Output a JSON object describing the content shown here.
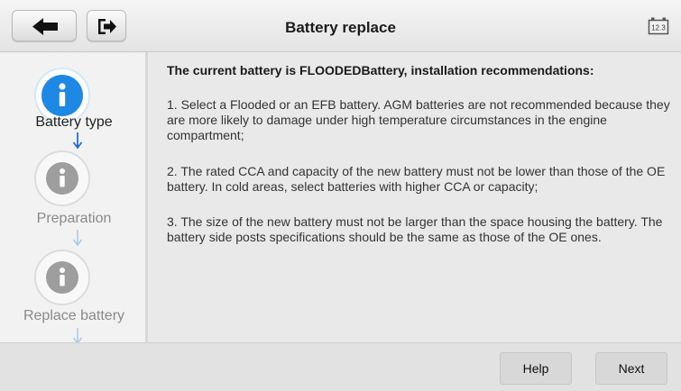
{
  "header": {
    "title": "Battery replace",
    "back_icon": "back-arrow-icon",
    "exit_icon": "exit-icon",
    "battery_icon": "battery-icon",
    "battery_label": "12.3"
  },
  "steps": [
    {
      "label": "Battery type",
      "state": "active",
      "icon": "info-icon"
    },
    {
      "label": "Preparation",
      "state": "inactive",
      "icon": "info-icon"
    },
    {
      "label": "Replace battery",
      "state": "inactive",
      "icon": "info-icon"
    }
  ],
  "content": {
    "heading": "The current battery is FLOODEDBattery, installation recommendations:",
    "paragraphs": [
      "1. Select a Flooded or an EFB battery. AGM batteries are not recommended because they are more likely to damage under high temperature circumstances in the engine compartment;",
      "2. The rated CCA and capacity of the new battery must not be lower than those of the OE battery. In cold areas, select batteries with higher CCA or capacity;",
      "3. The size of the new battery must not be larger than the space housing the battery. The battery side posts specifications should be the same as those of the OE ones."
    ]
  },
  "footer": {
    "help_label": "Help",
    "next_label": "Next"
  },
  "colors": {
    "active_step": "#1e88e5",
    "active_arrow": "#1e6fd0",
    "inactive_step": "#9e9e9e",
    "inactive_arrow": "#a9cbe8"
  }
}
